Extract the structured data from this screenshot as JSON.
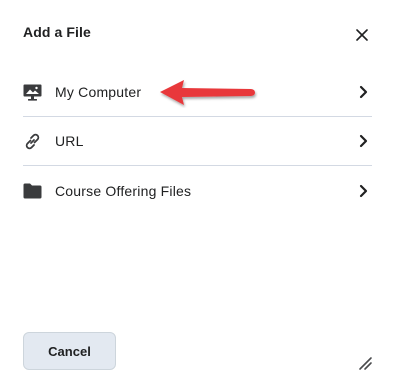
{
  "dialog": {
    "title": "Add a File",
    "close_icon": "close-icon"
  },
  "items": [
    {
      "label": "My Computer",
      "icon": "monitor-icon"
    },
    {
      "label": "URL",
      "icon": "link-icon"
    },
    {
      "label": "Course Offering Files",
      "icon": "folder-icon"
    }
  ],
  "footer": {
    "cancel_label": "Cancel",
    "resize_icon": "resize-handle-icon"
  },
  "colors": {
    "annotation_arrow": "#e8393b",
    "divider": "#d3d9e3",
    "button_bg": "#e3e9f1",
    "text": "#202122"
  }
}
